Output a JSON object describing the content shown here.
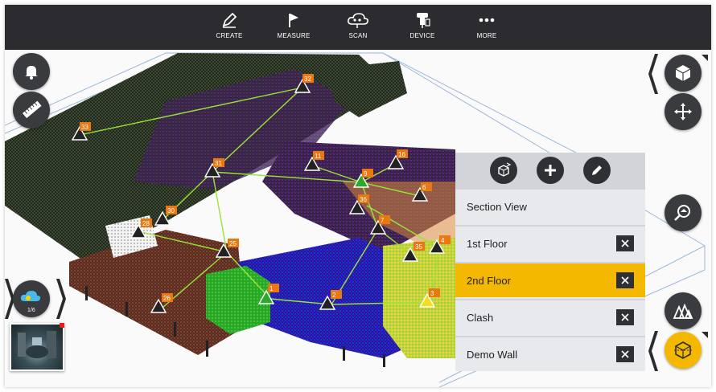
{
  "toolbar": {
    "items": [
      {
        "label": "CREATE",
        "icon": "pencil-icon"
      },
      {
        "label": "MEASURE",
        "icon": "flag-icon"
      },
      {
        "label": "SCAN",
        "icon": "cloud-icon"
      },
      {
        "label": "DEVICE",
        "icon": "scanner-icon"
      },
      {
        "label": "MORE",
        "icon": "more-icon"
      }
    ]
  },
  "left_controls": {
    "scan_counter": "1/6"
  },
  "panel": {
    "header_buttons": [
      "add-view-icon",
      "plus-icon",
      "edit-icon"
    ],
    "rows": [
      {
        "label": "Section View",
        "closable": false,
        "active": false
      },
      {
        "label": "1st Floor",
        "closable": true,
        "active": false
      },
      {
        "label": "2nd Floor",
        "closable": true,
        "active": true
      },
      {
        "label": "Clash",
        "closable": true,
        "active": false
      },
      {
        "label": "Demo Wall",
        "closable": true,
        "active": false
      }
    ]
  },
  "scan_markers": [
    "32",
    "33",
    "31",
    "11",
    "16",
    "9",
    "6",
    "36",
    "7",
    "30",
    "28",
    "25",
    "35",
    "4",
    "1",
    "2",
    "3",
    "26"
  ],
  "colors": {
    "toolbar": "#2b2b30",
    "accent": "#f5b800",
    "marker_label": "#e8780f",
    "path_line": "#9be33a"
  }
}
